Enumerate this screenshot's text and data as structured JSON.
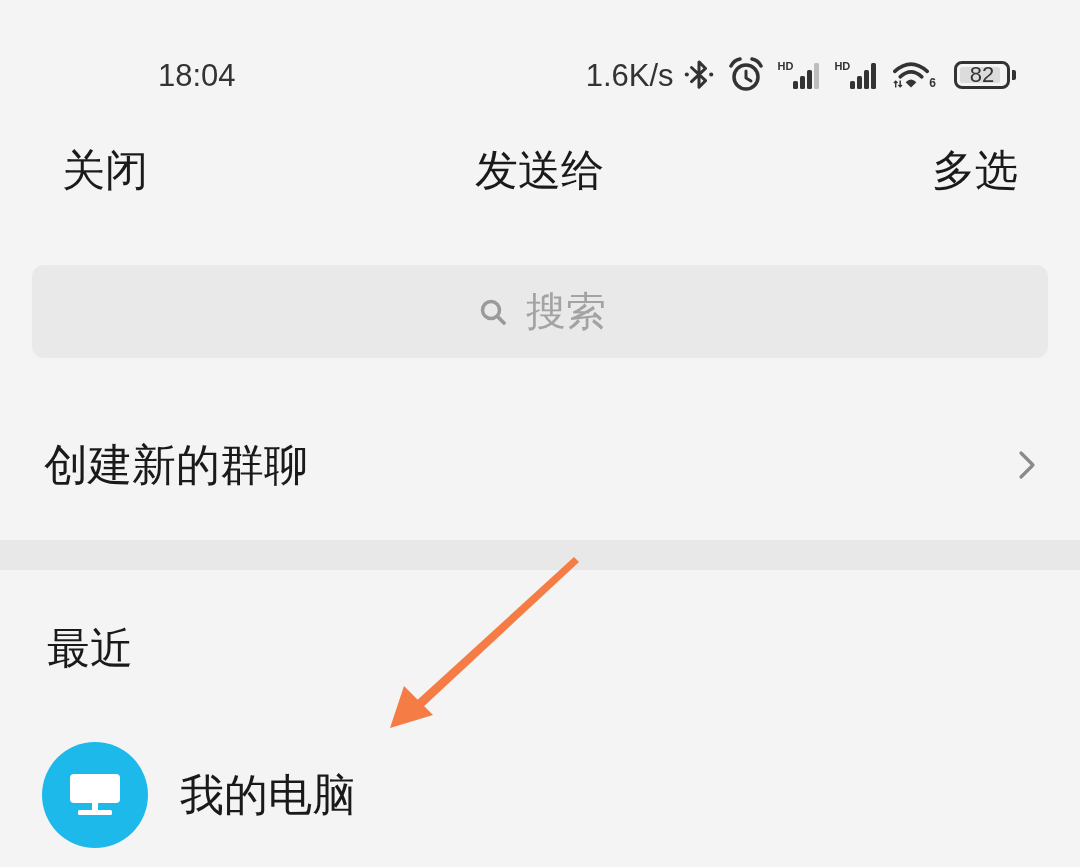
{
  "status_bar": {
    "time": "18:04",
    "network_speed": "1.6K/s",
    "signals": [
      {
        "label": "HD"
      },
      {
        "label": "HD"
      }
    ],
    "wifi": {
      "label": "6"
    },
    "battery": {
      "label": "82"
    }
  },
  "header": {
    "left_action": "关闭",
    "title": "发送给",
    "right_action": "多选"
  },
  "search": {
    "placeholder": "搜索"
  },
  "menu_items": [
    {
      "label": "创建新的群聊"
    }
  ],
  "sections": [
    {
      "title": "最近",
      "contacts": [
        {
          "name": "我的电脑"
        }
      ]
    }
  ]
}
